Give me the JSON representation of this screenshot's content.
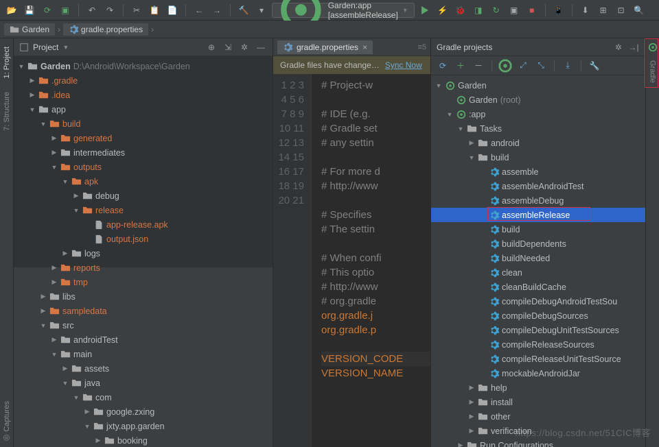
{
  "breadcrumb": {
    "root": "Garden",
    "file": "gradle.properties"
  },
  "runcfg": {
    "label": "Garden:app [assembleRelease]"
  },
  "project": {
    "panel_title": "Project",
    "root_name": "Garden",
    "root_path": "D:\\Android\\Workspace\\Garden",
    "items": [
      {
        "depth": 0,
        "arrow": "open",
        "icon": "folder",
        "label": "Garden",
        "orange": false,
        "suffix": "D:\\Android\\Workspace\\Garden",
        "sel": true
      },
      {
        "depth": 1,
        "arrow": "closed",
        "icon": "folder",
        "label": ".gradle",
        "orange": true,
        "sel": true
      },
      {
        "depth": 1,
        "arrow": "closed",
        "icon": "folder",
        "label": ".idea",
        "orange": true,
        "sel": true
      },
      {
        "depth": 1,
        "arrow": "open",
        "icon": "folder",
        "label": "app",
        "sel": true
      },
      {
        "depth": 2,
        "arrow": "open",
        "icon": "folder",
        "label": "build",
        "orange": true,
        "sel": true
      },
      {
        "depth": 3,
        "arrow": "closed",
        "icon": "folder",
        "label": "generated",
        "orange": true,
        "sel": true
      },
      {
        "depth": 3,
        "arrow": "closed",
        "icon": "folder",
        "label": "intermediates",
        "sel": true
      },
      {
        "depth": 3,
        "arrow": "open",
        "icon": "folder",
        "label": "outputs",
        "orange": true,
        "sel": true
      },
      {
        "depth": 4,
        "arrow": "open",
        "icon": "folder",
        "label": "apk",
        "orange": true,
        "sel": true
      },
      {
        "depth": 5,
        "arrow": "closed",
        "icon": "folder",
        "label": "debug",
        "sel": true
      },
      {
        "depth": 5,
        "arrow": "open",
        "icon": "folder",
        "label": "release",
        "orange": true,
        "sel": true
      },
      {
        "depth": 6,
        "arrow": "none",
        "icon": "file",
        "label": "app-release.apk",
        "orange": true,
        "sel": true
      },
      {
        "depth": 6,
        "arrow": "none",
        "icon": "file",
        "label": "output.json",
        "orange": true,
        "sel": true
      },
      {
        "depth": 4,
        "arrow": "closed",
        "icon": "folder",
        "label": "logs",
        "sel": true
      },
      {
        "depth": 3,
        "arrow": "closed",
        "icon": "folder",
        "label": "reports",
        "orange": true
      },
      {
        "depth": 3,
        "arrow": "closed",
        "icon": "folder",
        "label": "tmp",
        "orange": true
      },
      {
        "depth": 2,
        "arrow": "closed",
        "icon": "folder",
        "label": "libs"
      },
      {
        "depth": 2,
        "arrow": "closed",
        "icon": "folder",
        "label": "sampledata",
        "orange": true
      },
      {
        "depth": 2,
        "arrow": "open",
        "icon": "folder",
        "label": "src"
      },
      {
        "depth": 3,
        "arrow": "closed",
        "icon": "folder",
        "label": "androidTest"
      },
      {
        "depth": 3,
        "arrow": "open",
        "icon": "folder",
        "label": "main"
      },
      {
        "depth": 4,
        "arrow": "closed",
        "icon": "folder",
        "label": "assets"
      },
      {
        "depth": 4,
        "arrow": "open",
        "icon": "folder",
        "label": "java"
      },
      {
        "depth": 5,
        "arrow": "open",
        "icon": "folder",
        "label": "com"
      },
      {
        "depth": 6,
        "arrow": "closed",
        "icon": "folder",
        "label": "google.zxing"
      },
      {
        "depth": 6,
        "arrow": "open",
        "icon": "folder",
        "label": "jxty.app.garden"
      },
      {
        "depth": 7,
        "arrow": "closed",
        "icon": "folder",
        "label": "booking"
      }
    ]
  },
  "editor": {
    "tab": "gradle.properties",
    "tabs_mini": "≡5",
    "notice": "Gradle files have change…",
    "sync": "Sync Now",
    "lines": [
      "# Project-w",
      "",
      "# IDE (e.g.",
      "# Gradle set",
      "# any settin",
      "",
      "# For more d",
      "# http://www",
      "",
      "# Specifies ",
      "# The settin",
      "",
      "# When confi",
      "# This optio",
      "# http://www",
      "# org.gradle",
      "org.gradle.j",
      "org.gradle.p",
      "",
      "VERSION_CODE",
      "VERSION_NAME"
    ],
    "class": [
      "c",
      "",
      "c",
      "c",
      "c",
      "",
      "c",
      "c",
      "",
      "c",
      "c",
      "",
      "c",
      "c",
      "c",
      "c",
      "k",
      "k",
      "",
      "k",
      "k"
    ],
    "hl": [
      false,
      false,
      false,
      false,
      false,
      false,
      false,
      false,
      false,
      false,
      false,
      false,
      false,
      false,
      false,
      false,
      false,
      false,
      false,
      true,
      false
    ]
  },
  "gradle": {
    "title": "Gradle projects",
    "items": [
      {
        "depth": 0,
        "arrow": "open",
        "icon": "logo",
        "label": "Garden"
      },
      {
        "depth": 1,
        "arrow": "none",
        "icon": "logo",
        "label": "Garden",
        "suffix": "(root)"
      },
      {
        "depth": 1,
        "arrow": "open",
        "icon": "logo",
        "label": ":app"
      },
      {
        "depth": 2,
        "arrow": "open",
        "icon": "folder",
        "label": "Tasks"
      },
      {
        "depth": 3,
        "arrow": "closed",
        "icon": "folder",
        "label": "android"
      },
      {
        "depth": 3,
        "arrow": "open",
        "icon": "folder",
        "label": "build"
      },
      {
        "depth": 4,
        "arrow": "none",
        "icon": "gear",
        "label": "assemble"
      },
      {
        "depth": 4,
        "arrow": "none",
        "icon": "gear",
        "label": "assembleAndroidTest"
      },
      {
        "depth": 4,
        "arrow": "none",
        "icon": "gear",
        "label": "assembleDebug"
      },
      {
        "depth": 4,
        "arrow": "none",
        "icon": "gear",
        "label": "assembleRelease",
        "selected": true,
        "box": true
      },
      {
        "depth": 4,
        "arrow": "none",
        "icon": "gear",
        "label": "build"
      },
      {
        "depth": 4,
        "arrow": "none",
        "icon": "gear",
        "label": "buildDependents"
      },
      {
        "depth": 4,
        "arrow": "none",
        "icon": "gear",
        "label": "buildNeeded"
      },
      {
        "depth": 4,
        "arrow": "none",
        "icon": "gear",
        "label": "clean"
      },
      {
        "depth": 4,
        "arrow": "none",
        "icon": "gear",
        "label": "cleanBuildCache"
      },
      {
        "depth": 4,
        "arrow": "none",
        "icon": "gear",
        "label": "compileDebugAndroidTestSou"
      },
      {
        "depth": 4,
        "arrow": "none",
        "icon": "gear",
        "label": "compileDebugSources"
      },
      {
        "depth": 4,
        "arrow": "none",
        "icon": "gear",
        "label": "compileDebugUnitTestSources"
      },
      {
        "depth": 4,
        "arrow": "none",
        "icon": "gear",
        "label": "compileReleaseSources"
      },
      {
        "depth": 4,
        "arrow": "none",
        "icon": "gear",
        "label": "compileReleaseUnitTestSource"
      },
      {
        "depth": 4,
        "arrow": "none",
        "icon": "gear",
        "label": "mockableAndroidJar"
      },
      {
        "depth": 3,
        "arrow": "closed",
        "icon": "folder",
        "label": "help"
      },
      {
        "depth": 3,
        "arrow": "closed",
        "icon": "folder",
        "label": "install"
      },
      {
        "depth": 3,
        "arrow": "closed",
        "icon": "folder",
        "label": "other"
      },
      {
        "depth": 3,
        "arrow": "closed",
        "icon": "folder",
        "label": "verification"
      },
      {
        "depth": 2,
        "arrow": "closed",
        "icon": "folder",
        "label": "Run Configurations"
      }
    ]
  },
  "right_tab": "Gradle",
  "watermark": "https://blog.csdn.net/51CIC博客"
}
